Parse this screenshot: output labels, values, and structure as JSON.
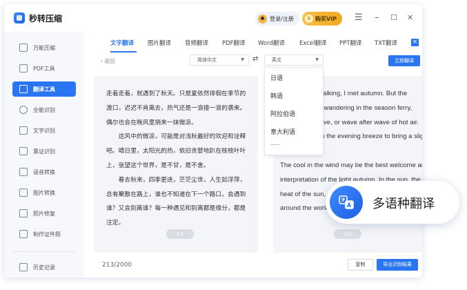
{
  "app": {
    "title": "秒转压缩"
  },
  "titlebar": {
    "login": "登录/注册",
    "vip": "购买VIP",
    "menu": "☰",
    "minimize": "–",
    "maximize": "☐",
    "close": "✕"
  },
  "sidebar": {
    "items": [
      {
        "label": "万能压缩",
        "icon": "compress-icon"
      },
      {
        "label": "PDF工具",
        "icon": "pdf-icon"
      },
      {
        "label": "翻译工具",
        "icon": "translate-icon"
      },
      {
        "label": "全能识别",
        "icon": "eye-icon"
      },
      {
        "label": "文字识别",
        "icon": "text-recognition-icon"
      },
      {
        "label": "票证识别",
        "icon": "ticket-icon"
      },
      {
        "label": "语音转换",
        "icon": "voice-icon"
      },
      {
        "label": "图片转换",
        "icon": "image-convert-icon"
      },
      {
        "label": "照片修复",
        "icon": "photo-repair-icon"
      },
      {
        "label": "制作证件照",
        "icon": "id-photo-icon"
      }
    ],
    "history": "历史记录"
  },
  "tabs": [
    "文字翻译",
    "图片翻译",
    "音频翻译",
    "PDF翻译",
    "Word翻译",
    "Excel翻译",
    "PPT翻译",
    "TXT翻译"
  ],
  "toolbar": {
    "back": "返回",
    "source_lang": "简体中文",
    "swap": "⇄",
    "target_lang": "英文",
    "translate": "立即翻译"
  },
  "dropdown": {
    "options": [
      "日语",
      "韩语",
      "阿拉伯语",
      "意大利语",
      "......"
    ]
  },
  "source_text": "走着走着，就遇到了秋天。只是夏依然徘徊在季节的渡口，迟迟不肯离去，热气还是一浪接一浪的袭来。偶尔也会在晚风里捎来一抹微凉。\n　　这风中的微凉，可能是对浅秋最好的欢迎和诠释吧。晴日里，太阳光的热，依旧贪婪地趴在枝枝叶叶上，张望这个世界，是不甘，是不舍。\n　　春去秋来，四季更迭，茫茫尘世，人生如浮萍，总有聚散在路上，谁也不知道在下一个路口，会遇到谁？又会别离谁？每一种遇见和别离都是缘分，都是注定。",
  "target_text": "Walking and walking, I met autumn. But the summer is still wandering in the season ferry, reluctant to leave, or wave after wave of hot air. Occasionally in the evening breeze to bring a slight cool.\nThe cool in the wind may be the best welcome and interpretation of the light autumn. In the sun, the heat of the sun, still greedy on the leaves, looking around the world.",
  "pager_left": "1/1",
  "pager_right": "1/2",
  "char_count": "213/2000",
  "buttons": {
    "copy": "复制",
    "export": "导出识别结果"
  },
  "callout": {
    "label": "多语种翻译"
  }
}
